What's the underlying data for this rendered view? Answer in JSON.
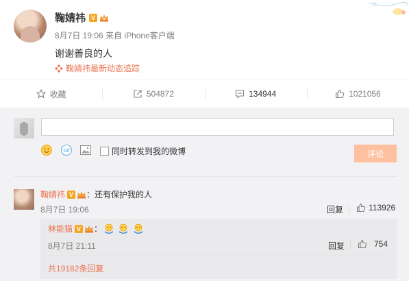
{
  "post": {
    "author": "鞠婧祎",
    "time": "8月7日 19:06",
    "source": "来自 iPhone客户端",
    "content": "谢谢善良的人",
    "tracking": "鞠婧祎最新动态追踪"
  },
  "actions": [
    {
      "label": "收藏",
      "icon": "star-icon"
    },
    {
      "label": "504872",
      "icon": "forward-icon"
    },
    {
      "label": "134944",
      "icon": "comment-icon"
    },
    {
      "label": "1021056",
      "icon": "like-icon"
    }
  ],
  "composer": {
    "input_value": "",
    "input_placeholder": "",
    "forward_label": "同时转发到我的微博",
    "submit_label": "评论"
  },
  "comment": {
    "author": "鞠婧祎",
    "separator": "：",
    "text": "还有保护我的人",
    "time": "8月7日 19:06",
    "reply_label": "回复",
    "likes": "113926"
  },
  "sub_comment": {
    "author": "林能猫",
    "separator": "：",
    "time": "8月7日 21:11",
    "reply_label": "回复",
    "likes": "754",
    "emoji_count": 3
  },
  "more_replies": "共19182条回复",
  "colors": {
    "accent": "#eb7350",
    "verified": "#f5a623",
    "submit_disabled": "#ffc09f",
    "panel_bg": "#f2f2f5"
  }
}
